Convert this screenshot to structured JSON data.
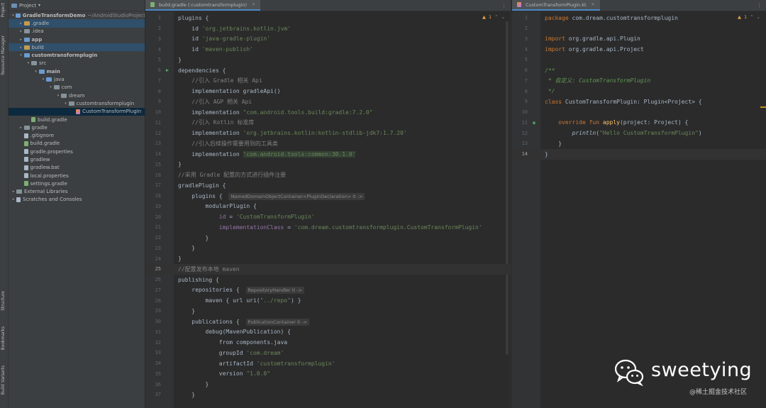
{
  "sidebar_stripe": {
    "top_tools": [
      "Project",
      "Resource Manager"
    ],
    "bottom_tools": [
      "Structure",
      "Bookmarks",
      "Build Variants"
    ]
  },
  "project_panel": {
    "header_label": "Project",
    "tree": [
      {
        "depth": 0,
        "arrow": "▾",
        "icon": "folder-blue",
        "label": "GradleTransformDemo",
        "suffix": "~/AndroidStudioProject",
        "bold": true
      },
      {
        "depth": 1,
        "arrow": "▸",
        "icon": "folder-orange",
        "label": ".gradle",
        "hl": true
      },
      {
        "depth": 1,
        "arrow": "▸",
        "icon": "folder-gray",
        "label": ".idea"
      },
      {
        "depth": 1,
        "arrow": "▸",
        "icon": "folder-blue",
        "label": "app",
        "bold": true
      },
      {
        "depth": 1,
        "arrow": "▸",
        "icon": "folder-orange",
        "label": "build",
        "hl": true
      },
      {
        "depth": 1,
        "arrow": "▾",
        "icon": "folder-blue",
        "label": "customtransformplugin",
        "bold": true
      },
      {
        "depth": 2,
        "arrow": "▾",
        "icon": "folder-gray",
        "label": "src"
      },
      {
        "depth": 3,
        "arrow": "▾",
        "icon": "folder-blue",
        "label": "main",
        "bold": true
      },
      {
        "depth": 4,
        "arrow": "▾",
        "icon": "folder-blue",
        "label": "java"
      },
      {
        "depth": 5,
        "arrow": "▾",
        "icon": "folder-gray",
        "label": "com"
      },
      {
        "depth": 6,
        "arrow": "▾",
        "icon": "folder-gray",
        "label": "dream"
      },
      {
        "depth": 7,
        "arrow": "▾",
        "icon": "folder-gray",
        "label": "customtransformplugin"
      },
      {
        "depth": 8,
        "arrow": "",
        "icon": "file-kt",
        "label": "CustomTransformPlugin",
        "sel": true
      },
      {
        "depth": 2,
        "arrow": "",
        "icon": "file-gradle",
        "label": "build.gradle"
      },
      {
        "depth": 1,
        "arrow": "▸",
        "icon": "folder-gray",
        "label": "gradle"
      },
      {
        "depth": 1,
        "arrow": "",
        "icon": "file-txt",
        "label": ".gitignore"
      },
      {
        "depth": 1,
        "arrow": "",
        "icon": "file-gradle",
        "label": "build.gradle"
      },
      {
        "depth": 1,
        "arrow": "",
        "icon": "file-txt",
        "label": "gradle.properties"
      },
      {
        "depth": 1,
        "arrow": "",
        "icon": "file-txt",
        "label": "gradlew"
      },
      {
        "depth": 1,
        "arrow": "",
        "icon": "file-txt",
        "label": "gradlew.bat"
      },
      {
        "depth": 1,
        "arrow": "",
        "icon": "file-txt",
        "label": "local.properties"
      },
      {
        "depth": 1,
        "arrow": "",
        "icon": "file-gradle",
        "label": "settings.gradle"
      },
      {
        "depth": 0,
        "arrow": "▸",
        "icon": "libraries",
        "label": "External Libraries"
      },
      {
        "depth": 0,
        "arrow": "▸",
        "icon": "scratches",
        "label": "Scratches and Consoles"
      }
    ]
  },
  "left_editor": {
    "tab_label": "build.gradle (:customtransformplugin)",
    "warning_count": "1",
    "current_line": 25,
    "lines": [
      {
        "n": 1,
        "toks": [
          [
            "kw0",
            "plugins {"
          ]
        ]
      },
      {
        "n": 2,
        "toks": [
          [
            "df",
            "    id "
          ],
          [
            "st",
            "'org.jetbrains.kotlin.jvm'"
          ]
        ]
      },
      {
        "n": 3,
        "toks": [
          [
            "df",
            "    id "
          ],
          [
            "st",
            "'java-gradle-plugin'"
          ]
        ]
      },
      {
        "n": 4,
        "toks": [
          [
            "df",
            "    id "
          ],
          [
            "st",
            "'maven-publish'"
          ]
        ]
      },
      {
        "n": 5,
        "toks": [
          [
            "df",
            "}"
          ]
        ]
      },
      {
        "n": 6,
        "run": true,
        "toks": [
          [
            "df",
            "dependencies {"
          ]
        ]
      },
      {
        "n": 7,
        "toks": [
          [
            "cm",
            "    //引入 Gradle 相关 Api"
          ]
        ]
      },
      {
        "n": 8,
        "toks": [
          [
            "df",
            "    implementation gradleApi()"
          ]
        ]
      },
      {
        "n": 9,
        "toks": [
          [
            "cm",
            "    //引入 AGP 相关 Api"
          ]
        ]
      },
      {
        "n": 10,
        "toks": [
          [
            "df",
            "    implementation "
          ],
          [
            "st",
            "\"com.android.tools.build:gradle:7.2.0\""
          ]
        ]
      },
      {
        "n": 11,
        "toks": [
          [
            "cm",
            "    //引入 Kotlin 标准库"
          ]
        ]
      },
      {
        "n": 12,
        "toks": [
          [
            "df",
            "    implementation "
          ],
          [
            "st",
            "'org.jetbrains.kotlin:kotlin-stdlib-jdk7:1.7.20'"
          ]
        ]
      },
      {
        "n": 13,
        "toks": [
          [
            "cm",
            "    //引入后续操作需要用到的工具类"
          ]
        ]
      },
      {
        "n": 14,
        "toks": [
          [
            "df",
            "    implementation "
          ],
          [
            "sthl",
            "'com.android.tools:common:30.1.0'"
          ]
        ]
      },
      {
        "n": 15,
        "toks": [
          [
            "df",
            "}"
          ]
        ]
      },
      {
        "n": 16,
        "toks": [
          [
            "cm",
            "//采用 Gradle 配置的方式进行插件注册"
          ]
        ]
      },
      {
        "n": 17,
        "toks": [
          [
            "df",
            "gradlePlugin {"
          ]
        ]
      },
      {
        "n": 18,
        "toks": [
          [
            "df",
            "    plugins { "
          ],
          [
            "hint",
            "NamedDomainObjectContainer<PluginDeclaration> it ->"
          ]
        ]
      },
      {
        "n": 19,
        "toks": [
          [
            "df",
            "        modularPlugin {"
          ]
        ]
      },
      {
        "n": 20,
        "toks": [
          [
            "ident",
            "            id"
          ],
          [
            "df",
            " = "
          ],
          [
            "st",
            "'CustomTransformPlugin'"
          ]
        ]
      },
      {
        "n": 21,
        "toks": [
          [
            "ident",
            "            implementationClass"
          ],
          [
            "df",
            " = "
          ],
          [
            "st",
            "'com.dream.customtransformplugin.CustomTransformPlugin'"
          ]
        ]
      },
      {
        "n": 22,
        "toks": [
          [
            "df",
            "        }"
          ]
        ]
      },
      {
        "n": 23,
        "toks": [
          [
            "df",
            "    }"
          ]
        ]
      },
      {
        "n": 24,
        "toks": [
          [
            "df",
            "}"
          ]
        ]
      },
      {
        "n": 25,
        "toks": [
          [
            "cm",
            "//配置发布本地 maven"
          ]
        ]
      },
      {
        "n": 26,
        "toks": [
          [
            "df",
            "publishing {"
          ]
        ]
      },
      {
        "n": 27,
        "toks": [
          [
            "df",
            "    repositories { "
          ],
          [
            "hint",
            "RepositoryHandler it ->"
          ]
        ]
      },
      {
        "n": 28,
        "toks": [
          [
            "df",
            "        maven { url uri("
          ],
          [
            "st",
            "\"../repo\""
          ],
          [
            "df",
            ") }"
          ]
        ]
      },
      {
        "n": 29,
        "toks": [
          [
            "df",
            "    }"
          ]
        ]
      },
      {
        "n": 30,
        "toks": [
          [
            "df",
            "    publications { "
          ],
          [
            "hint",
            "PublicationContainer it ->"
          ]
        ]
      },
      {
        "n": 31,
        "toks": [
          [
            "df",
            "        debug(MavenPublication) {"
          ]
        ]
      },
      {
        "n": 32,
        "toks": [
          [
            "df",
            "            from components.java"
          ]
        ]
      },
      {
        "n": 33,
        "toks": [
          [
            "df",
            "            groupId "
          ],
          [
            "st",
            "'com.dream'"
          ]
        ]
      },
      {
        "n": 34,
        "toks": [
          [
            "df",
            "            artifactId "
          ],
          [
            "st",
            "'customtransformplugin'"
          ]
        ]
      },
      {
        "n": 35,
        "toks": [
          [
            "df",
            "            version "
          ],
          [
            "st",
            "\"1.0.0\""
          ]
        ]
      },
      {
        "n": 36,
        "toks": [
          [
            "df",
            "        }"
          ]
        ]
      },
      {
        "n": 37,
        "toks": [
          [
            "df",
            "    }"
          ]
        ]
      }
    ]
  },
  "right_editor": {
    "tab_label": "CustomTransformPlugin.kt",
    "warning_count": "1",
    "current_line": 14,
    "lines": [
      {
        "n": 1,
        "toks": [
          [
            "kw",
            "package "
          ],
          [
            "df",
            "com.dream.customtransformplugin"
          ]
        ]
      },
      {
        "n": 2,
        "toks": []
      },
      {
        "n": 3,
        "toks": [
          [
            "kw",
            "import "
          ],
          [
            "df",
            "org.gradle.api.Plugin"
          ]
        ]
      },
      {
        "n": 4,
        "toks": [
          [
            "kw",
            "import "
          ],
          [
            "df",
            "org.gradle.api.Project"
          ]
        ]
      },
      {
        "n": 5,
        "toks": []
      },
      {
        "n": 6,
        "toks": [
          [
            "cmit",
            "/**"
          ]
        ]
      },
      {
        "n": 7,
        "toks": [
          [
            "cmit",
            " * 自定义: "
          ],
          [
            "cmitb",
            "CustomTransformPlugin"
          ]
        ]
      },
      {
        "n": 8,
        "toks": [
          [
            "cmit",
            " */"
          ]
        ]
      },
      {
        "n": 9,
        "toks": [
          [
            "kw",
            "class "
          ],
          [
            "df",
            "CustomTransformPlugin: Plugin<Project> {"
          ]
        ]
      },
      {
        "n": 10,
        "toks": []
      },
      {
        "n": 11,
        "mark": true,
        "toks": [
          [
            "kw",
            "    override fun "
          ],
          [
            "fn",
            "apply"
          ],
          [
            "df",
            "(project: Project) {"
          ]
        ]
      },
      {
        "n": 12,
        "toks": [
          [
            "df",
            "        "
          ],
          [
            "itdf",
            "println"
          ],
          [
            "df",
            "("
          ],
          [
            "st",
            "\"Hello CustomTransformPlugin\""
          ],
          [
            "df",
            ")"
          ]
        ]
      },
      {
        "n": 13,
        "toks": [
          [
            "df",
            "    }"
          ]
        ]
      },
      {
        "n": 14,
        "toks": [
          [
            "df",
            "}"
          ]
        ]
      }
    ]
  },
  "watermark": {
    "name": "sweetying",
    "source": "@稀土掘金技术社区"
  },
  "colors": {
    "editor_bg": "#2b2b2b",
    "panel_bg": "#3c3f41",
    "keyword": "#cc7832",
    "string": "#6a8759",
    "comment": "#808080",
    "selection": "#0d293e"
  }
}
